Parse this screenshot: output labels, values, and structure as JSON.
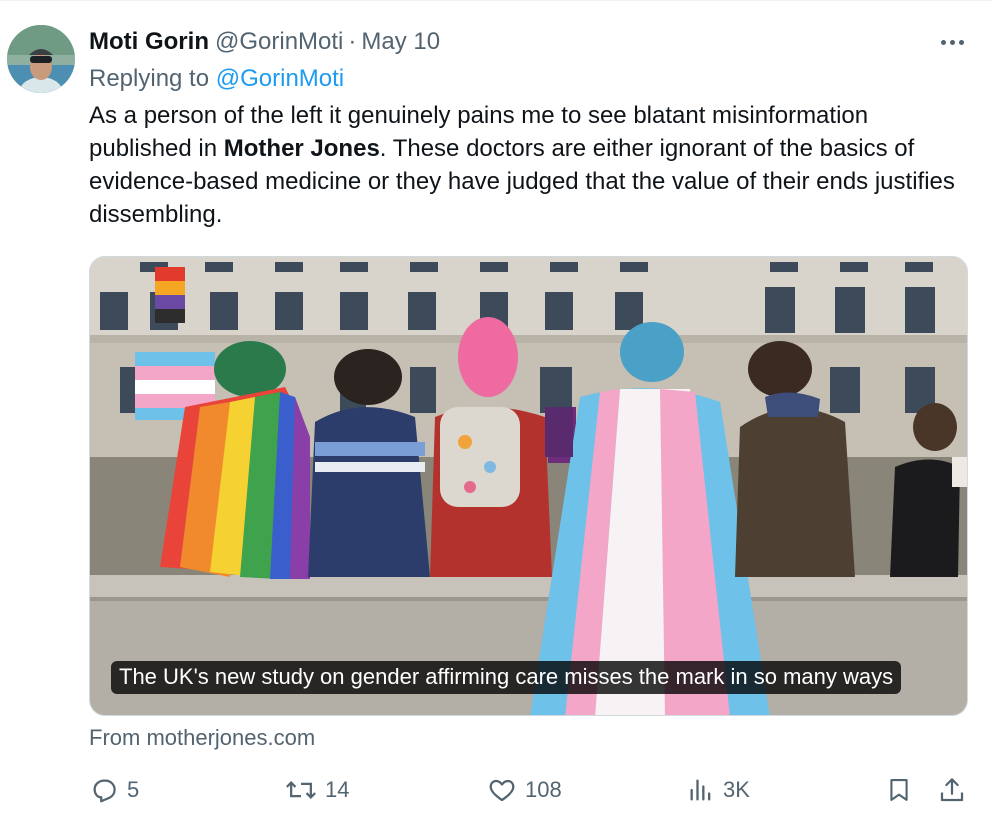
{
  "tweet": {
    "author_name": "Moti Gorin",
    "author_handle": "@GorinMoti",
    "separator": "·",
    "date": "May 10",
    "replying_prefix": "Replying to",
    "replying_to": "@GorinMoti",
    "text_part1": "As a person of the left it genuinely pains me to see blatant misinformation published in ",
    "text_bold": "Mother Jones",
    "text_part2": ". These doctors are either ignorant of the basics of evidence-based medicine or they have judged that the value of their ends justifies dissembling."
  },
  "link_card": {
    "caption": "The UK's new study on gender affirming care misses the mark in so many ways",
    "source": "From motherjones.com"
  },
  "actions": {
    "replies": "5",
    "retweets": "14",
    "likes": "108",
    "views": "3K"
  },
  "icons": {
    "more": "more-horizontal-icon",
    "reply": "reply-bubble-icon",
    "retweet": "retweet-icon",
    "like": "heart-icon",
    "views": "analytics-bars-icon",
    "bookmark": "bookmark-icon",
    "share": "share-upload-icon"
  },
  "colors": {
    "text": "#0f1419",
    "secondary": "#536471",
    "link": "#1d9bf0",
    "border": "#cfd9de"
  }
}
